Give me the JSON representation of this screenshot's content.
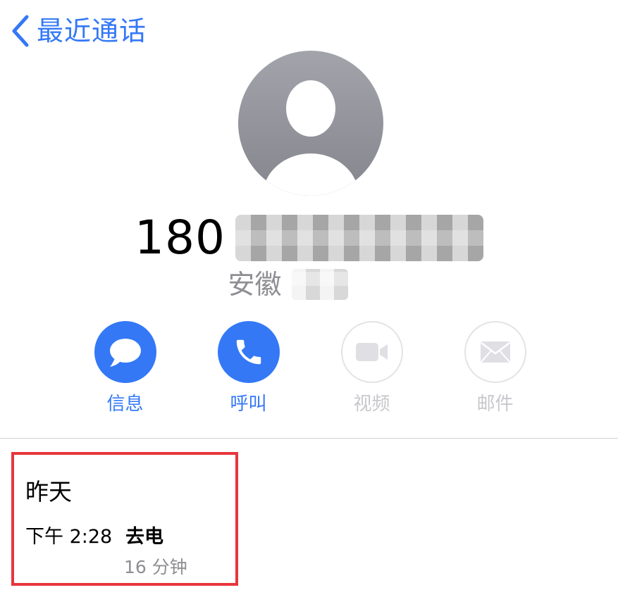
{
  "nav": {
    "back_label": "最近通话"
  },
  "contact": {
    "number_prefix": "180",
    "region": "安徽"
  },
  "actions": [
    {
      "label": "信息",
      "icon": "message-bubble-icon",
      "enabled": true
    },
    {
      "label": "呼叫",
      "icon": "phone-icon",
      "enabled": true
    },
    {
      "label": "视频",
      "icon": "video-camera-icon",
      "enabled": false
    },
    {
      "label": "邮件",
      "icon": "mail-envelope-icon",
      "enabled": false
    }
  ],
  "call_log": {
    "day": "昨天",
    "time": "下午 2:28",
    "type": "去电",
    "duration": "16 分钟"
  },
  "colors": {
    "accent": "#3478f6",
    "disabled": "#c7c7cc",
    "highlight_border": "#e8353d"
  }
}
